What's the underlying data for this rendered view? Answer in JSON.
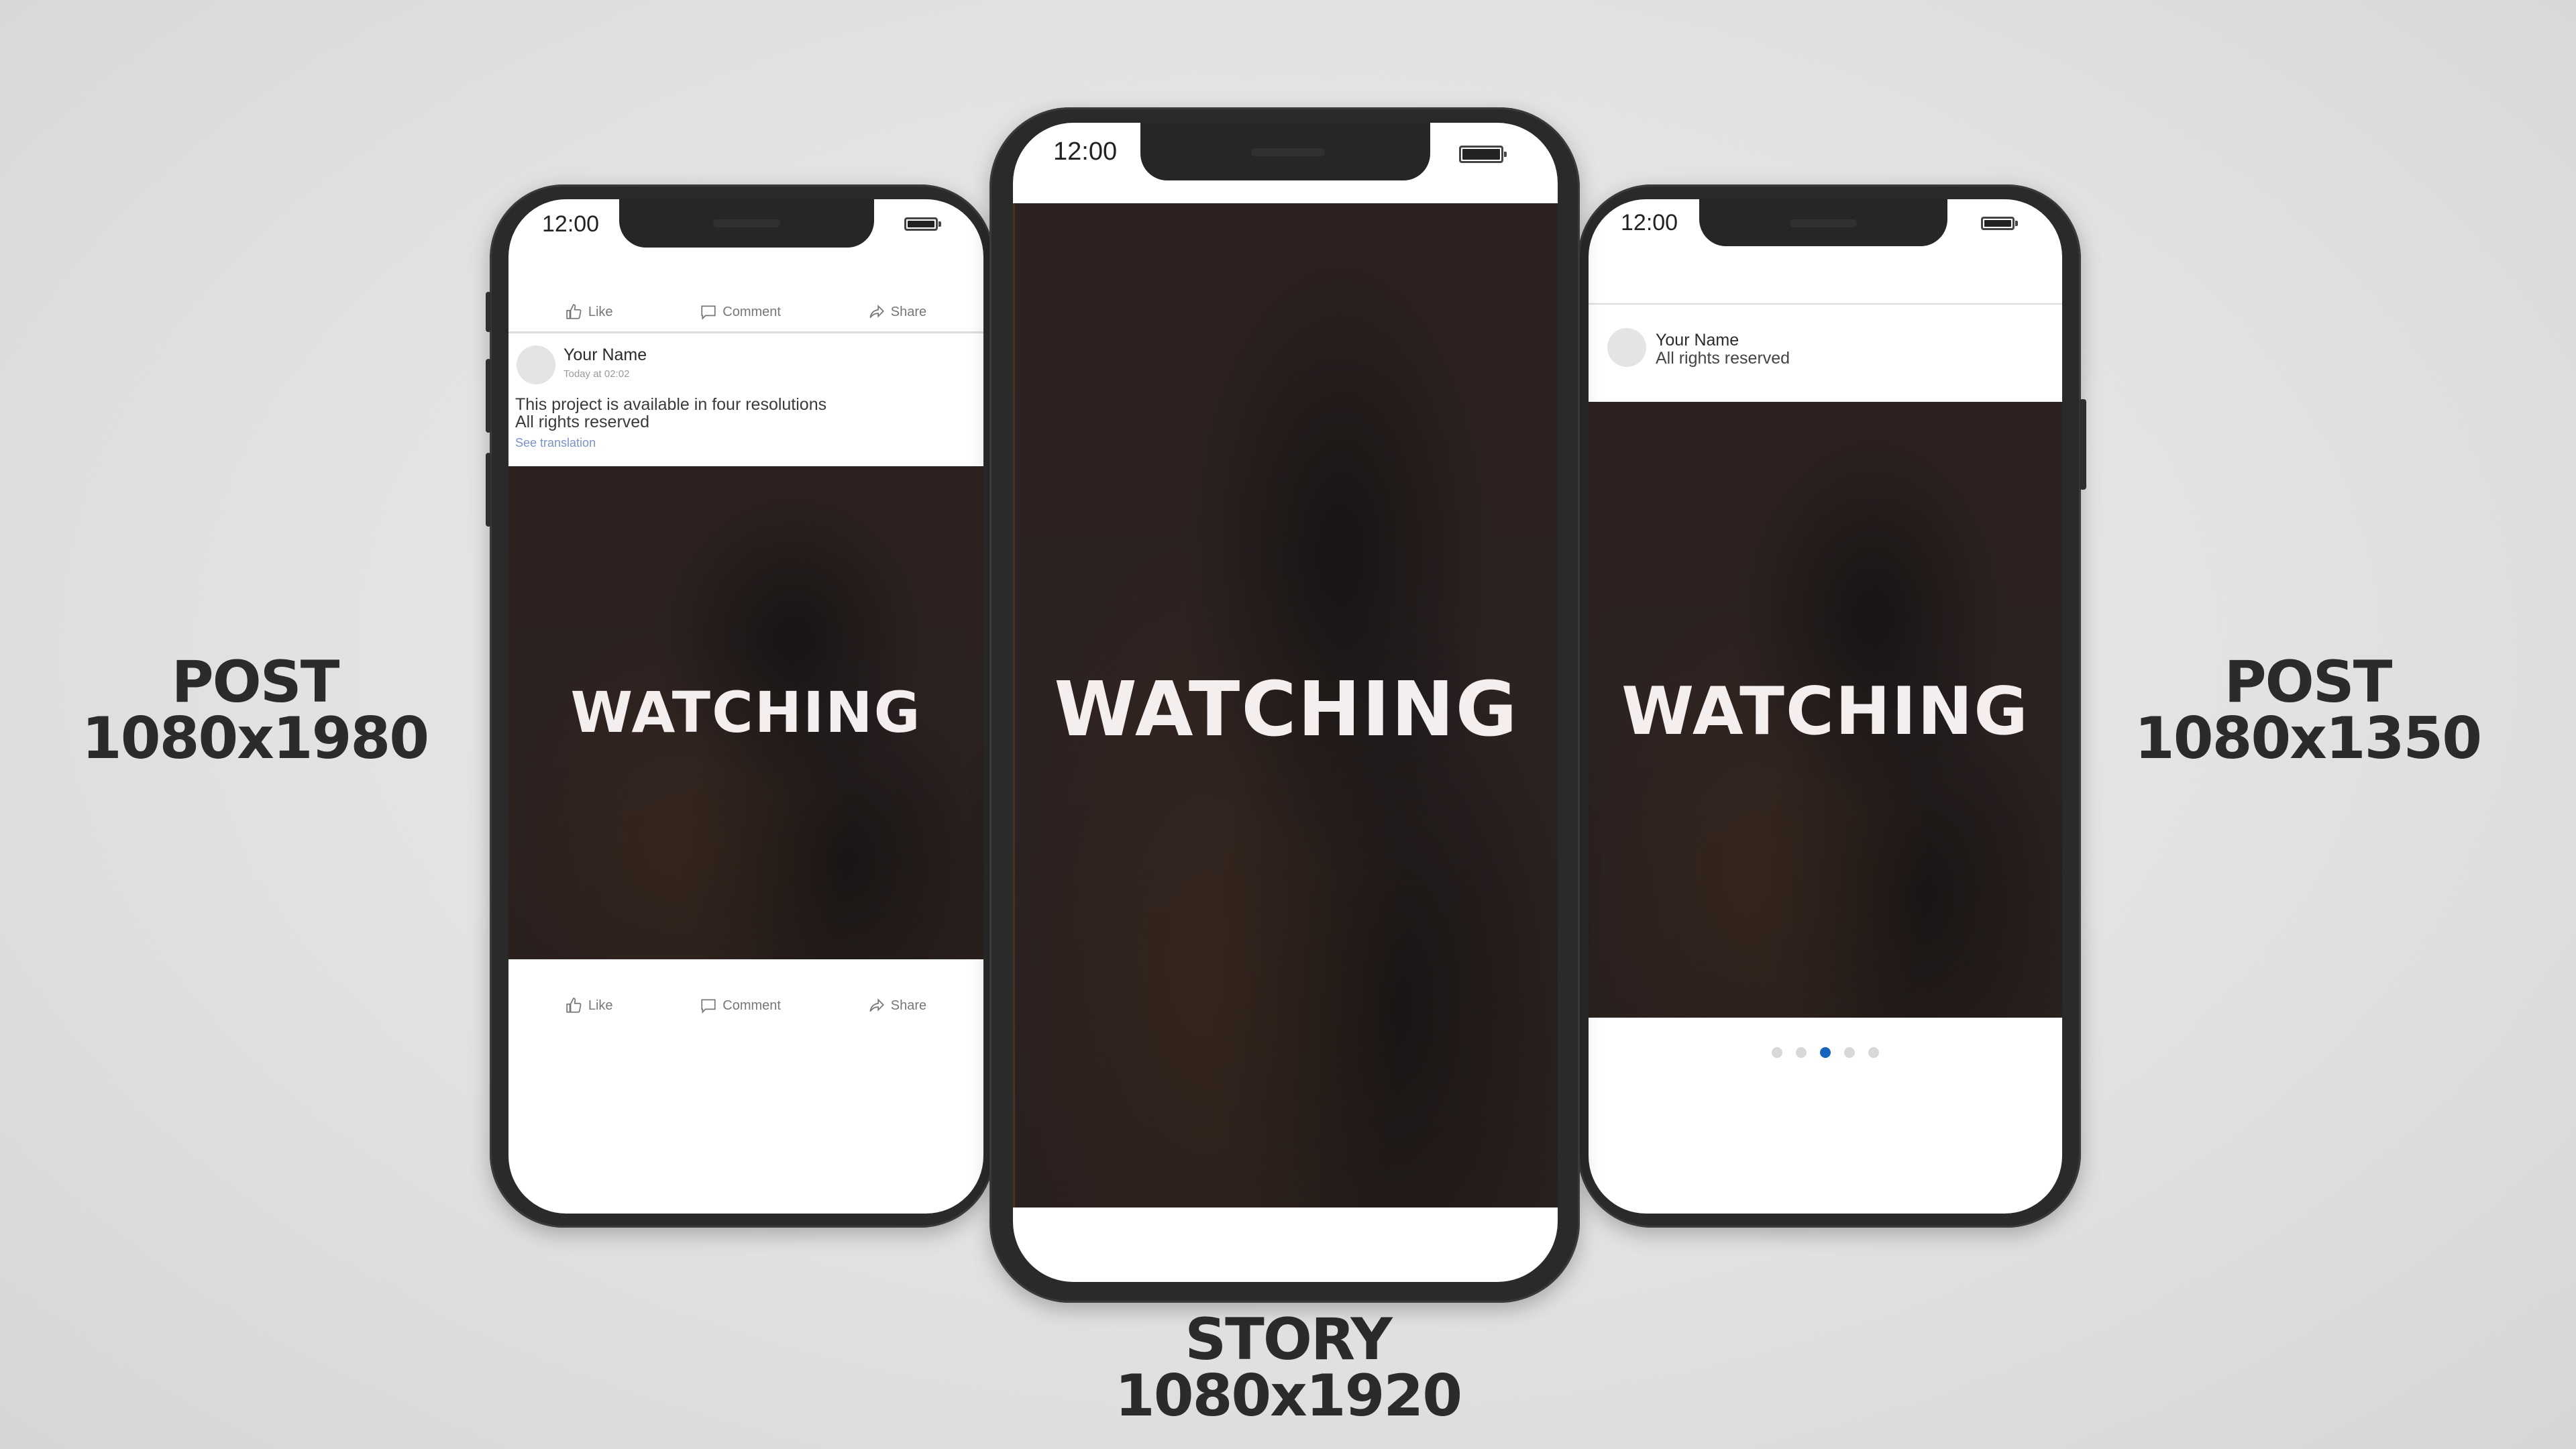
{
  "labels": {
    "left": {
      "line1": "POST",
      "line2": "1080x1980"
    },
    "center": {
      "line1": "STORY",
      "line2": "1080x1920"
    },
    "right": {
      "line1": "POST",
      "line2": "1080x1350"
    }
  },
  "phones": {
    "left": {
      "status_time": "12:00",
      "top_actions": [
        "Like",
        "Comment",
        "Share"
      ],
      "author": "Your Name",
      "timestamp": "Today at 02:02",
      "post_text_line1": "This project is available in four resolutions",
      "post_text_line2": "All rights reserved",
      "see_translation": "See translation",
      "media_title": "WATCHING",
      "bottom_actions": [
        "Like",
        "Comment",
        "Share"
      ]
    },
    "center": {
      "status_time": "12:00",
      "media_title": "WATCHING"
    },
    "right": {
      "status_time": "12:00",
      "author": "Your Name",
      "subtitle": "All rights reserved",
      "media_title": "WATCHING",
      "carousel": {
        "count": 5,
        "active_index": 2
      }
    }
  },
  "colors": {
    "background": "#e2e2e2",
    "phone_frame": "#2a2a2a",
    "media_bg": "#2c2222",
    "label_text": "#2b2b2b",
    "carousel_active": "#1565c0",
    "carousel_inactive": "#d8d8d8",
    "link": "#7b93c9"
  }
}
